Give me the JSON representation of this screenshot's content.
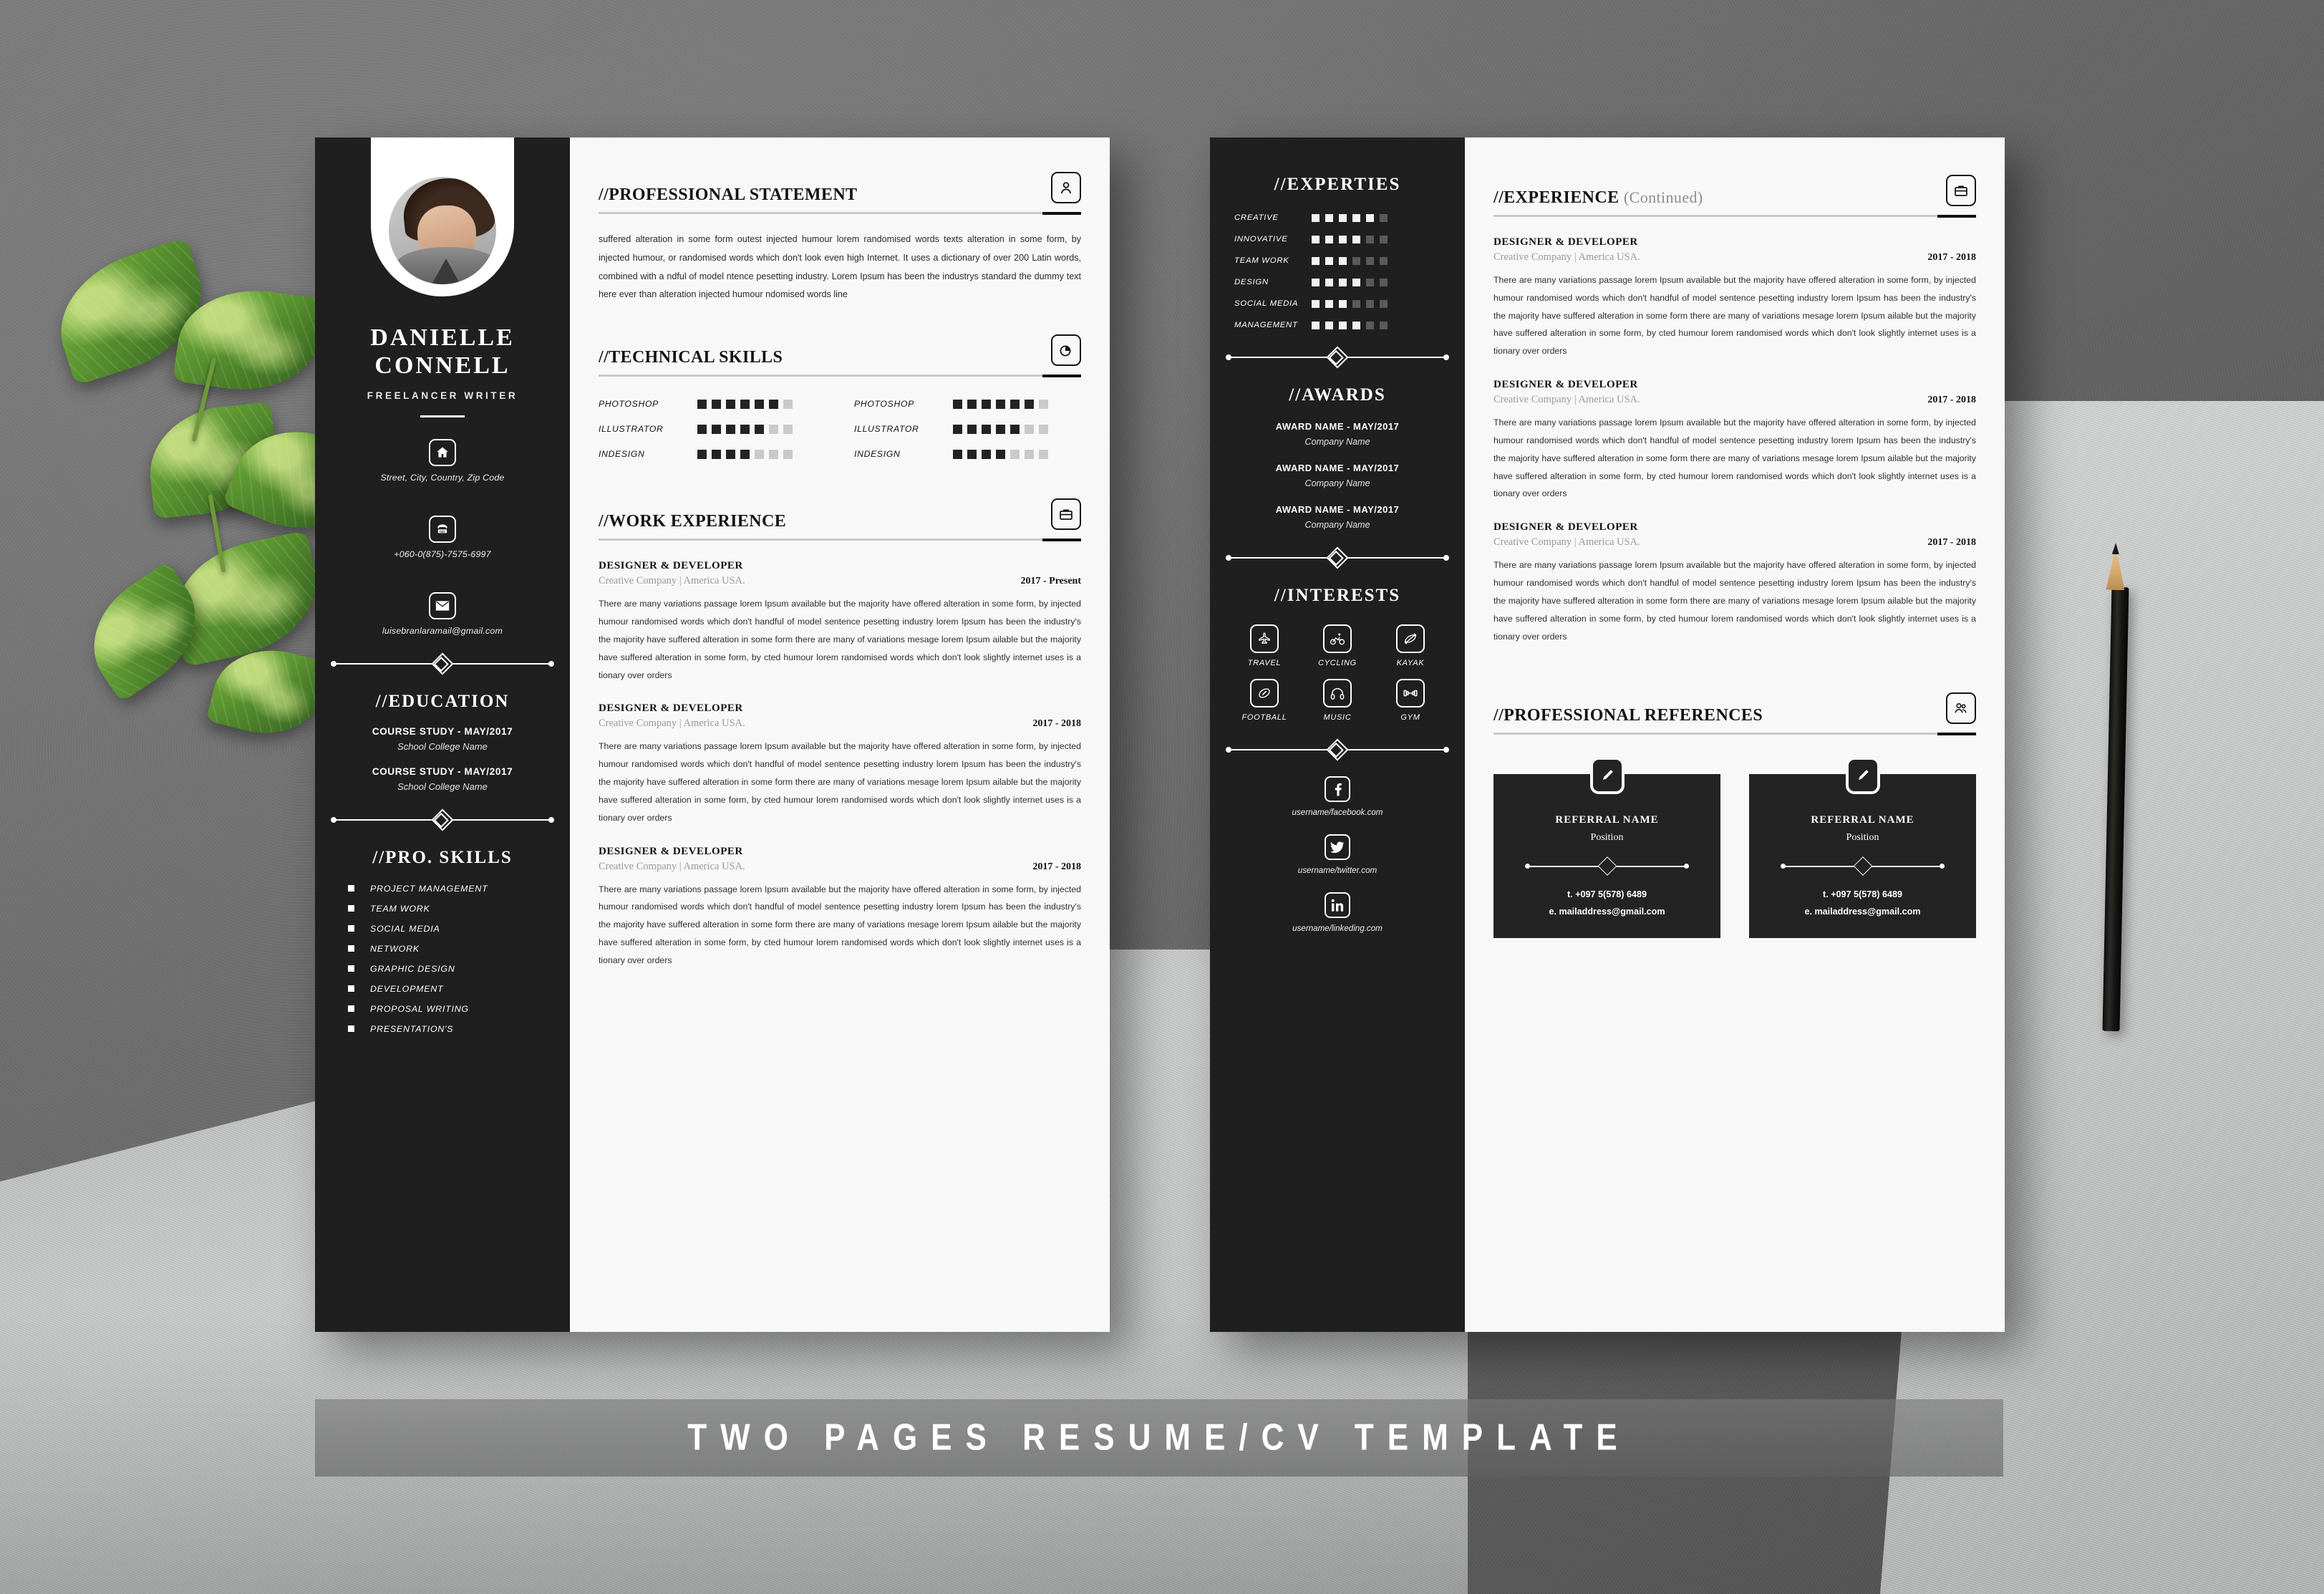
{
  "banner": {
    "text": "TWO PAGES RESUME/CV TEMPLATE"
  },
  "profile": {
    "first_name": "DANIELLE",
    "last_name": "CONNELL",
    "role": "FREELANCER WRITER",
    "photo_alt": "portrait-photo"
  },
  "contact": [
    {
      "icon": "home-icon",
      "glyph": "⌂",
      "text": "Street, City, Country, Zip Code"
    },
    {
      "icon": "phone-icon",
      "glyph": "☎",
      "text": "+060-0(875)-7575-6997"
    },
    {
      "icon": "mail-icon",
      "glyph": "✉",
      "text": "luisebranlaramail@gmail.com"
    }
  ],
  "education": {
    "heading": "//EDUCATION",
    "items": [
      {
        "title": "COURSE STUDY - MAY/2017",
        "school": "School College Name"
      },
      {
        "title": "COURSE STUDY - MAY/2017",
        "school": "School College Name"
      }
    ]
  },
  "pro_skills": {
    "heading": "//PRO. SKILLS",
    "items": [
      "PROJECT MANAGEMENT",
      "TEAM WORK",
      "SOCIAL MEDIA",
      "NETWORK",
      "GRAPHIC DESIGN",
      "DEVELOPMENT",
      "PROPOSAL WRITING",
      "PRESENTATION'S"
    ]
  },
  "professional_statement": {
    "heading": "//PROFESSIONAL STATEMENT",
    "icon": "person-card-icon",
    "text": "suffered alteration in some form outest injected humour lorem randomised words texts alteration in some form, by injected humour, or randomised words which don't look even high Internet. It uses a dictionary of over 200 Latin words, combined with a ndful of model ntence pesetting industry. Lorem Ipsum has been the industrys standard the dummy text here ever than alteration injected humour ndomised words line"
  },
  "technical_skills": {
    "heading": "//TECHNICAL SKILLS",
    "icon": "pie-chart-icon",
    "total": 7,
    "columns": [
      [
        {
          "label": "PHOTOSHOP",
          "value": 6
        },
        {
          "label": "ILLUSTRATOR",
          "value": 5
        },
        {
          "label": "INDESIGN",
          "value": 4
        }
      ],
      [
        {
          "label": "PHOTOSHOP",
          "value": 6
        },
        {
          "label": "ILLUSTRATOR",
          "value": 5
        },
        {
          "label": "INDESIGN",
          "value": 4
        }
      ]
    ]
  },
  "work_experience": {
    "heading": "//WORK EXPERIENCE",
    "icon": "briefcase-icon",
    "jobs": [
      {
        "title": "DESIGNER & DEVELOPER",
        "company": "Creative Company | America USA.",
        "date": "2017 - Present",
        "desc": "There are many variations passage lorem Ipsum available but the majority have offered alteration in some form, by injected humour randomised words which don't handful of model sentence pesetting industry lorem Ipsum has been the industry's the majority have suffered alteration in some form there are many of variations mesage lorem Ipsum ailable but the majority have suffered alteration in some form, by cted humour lorem randomised words which don't look slightly internet uses is a tionary over orders"
      },
      {
        "title": "DESIGNER & DEVELOPER",
        "company": "Creative Company | America USA.",
        "date": "2017 - 2018",
        "desc": "There are many variations passage lorem Ipsum available but the majority have offered alteration in some form, by injected humour randomised words which don't handful of model sentence pesetting industry lorem Ipsum has been the industry's the majority have suffered alteration in some form there are many of variations mesage lorem Ipsum ailable but the majority have suffered alteration in some form, by cted humour lorem randomised words which don't look slightly internet uses is a tionary over orders"
      },
      {
        "title": "DESIGNER & DEVELOPER",
        "company": "Creative Company | America USA.",
        "date": "2017 - 2018",
        "desc": "There are many variations passage lorem Ipsum available but the majority have offered alteration in some form, by injected humour randomised words which don't handful of model sentence pesetting industry lorem Ipsum has been the industry's the majority have suffered alteration in some form there are many of variations mesage lorem Ipsum ailable but the majority have suffered alteration in some form, by cted humour lorem randomised words which don't look slightly internet uses is a tionary over orders"
      }
    ]
  },
  "experties": {
    "heading": "//EXPERTIES",
    "total": 6,
    "items": [
      {
        "label": "CREATIVE",
        "value": 5
      },
      {
        "label": "INNOVATIVE",
        "value": 4
      },
      {
        "label": "TEAM WORK",
        "value": 3
      },
      {
        "label": "DESIGN",
        "value": 4
      },
      {
        "label": "SOCIAL MEDIA",
        "value": 3
      },
      {
        "label": "MANAGEMENT",
        "value": 4
      }
    ]
  },
  "awards": {
    "heading": "//AWARDS",
    "items": [
      {
        "title": "AWARD NAME - MAY/2017",
        "company": "Company Name"
      },
      {
        "title": "AWARD NAME - MAY/2017",
        "company": "Company Name"
      },
      {
        "title": "AWARD NAME - MAY/2017",
        "company": "Company Name"
      }
    ]
  },
  "interests": {
    "heading": "//INTERESTS",
    "items": [
      {
        "label": "TRAVEL",
        "icon": "airplane-icon"
      },
      {
        "label": "CYCLING",
        "icon": "cyclist-icon"
      },
      {
        "label": "KAYAK",
        "icon": "kayak-icon"
      },
      {
        "label": "FOOTBALL",
        "icon": "football-icon"
      },
      {
        "label": "MUSIC",
        "icon": "headphones-icon"
      },
      {
        "label": "GYM",
        "icon": "dumbbell-icon"
      }
    ]
  },
  "social": [
    {
      "icon": "facebook-icon",
      "glyph": "f",
      "text": "username/facebook.com"
    },
    {
      "icon": "twitter-icon",
      "glyph": "ᵗ",
      "text": "username/twitter.com"
    },
    {
      "icon": "linkedin-icon",
      "glyph": "in",
      "text": "username/linkeding.com"
    }
  ],
  "experience_continued": {
    "heading": "//EXPERIENCE",
    "heading_suffix": "(Continued)",
    "icon": "briefcase-icon",
    "jobs": [
      {
        "title": "DESIGNER & DEVELOPER",
        "company": "Creative Company | America USA.",
        "date": "2017 - 2018",
        "desc": "There are many variations passage lorem Ipsum available but the majority have offered alteration in some form, by injected humour randomised words which don't handful of model sentence pesetting industry lorem Ipsum has been the industry's the majority have suffered alteration in some form there are many of variations mesage lorem Ipsum ailable but the majority have suffered alteration in some form, by cted humour lorem randomised words which don't look slightly internet uses is a tionary over orders"
      },
      {
        "title": "DESIGNER & DEVELOPER",
        "company": "Creative Company | America USA.",
        "date": "2017 - 2018",
        "desc": "There are many variations passage lorem Ipsum available but the majority have offered alteration in some form, by injected humour randomised words which don't handful of model sentence pesetting industry lorem Ipsum has been the industry's the majority have suffered alteration in some form there are many of variations mesage lorem Ipsum ailable but the majority have suffered alteration in some form, by cted humour lorem randomised words which don't look slightly internet uses is a tionary over orders"
      },
      {
        "title": "DESIGNER & DEVELOPER",
        "company": "Creative Company | America USA.",
        "date": "2017 - 2018",
        "desc": "There are many variations passage lorem Ipsum available but the majority have offered alteration in some form, by injected humour randomised words which don't handful of model sentence pesetting industry lorem Ipsum has been the industry's the majority have suffered alteration in some form there are many of variations mesage lorem Ipsum ailable but the majority have suffered alteration in some form, by cted humour lorem randomised words which don't look slightly internet uses is a tionary over orders"
      }
    ]
  },
  "references": {
    "heading": "//PROFESSIONAL REFERENCES",
    "icon": "people-card-icon",
    "cards": [
      {
        "badge_icon": "pen-icon",
        "name": "REFERRAL NAME",
        "position": "Position",
        "tel": "t. +097 5(578) 6489",
        "mail": "e. mailaddress@gmail.com"
      },
      {
        "badge_icon": "pen-icon",
        "name": "REFERRAL NAME",
        "position": "Position",
        "tel": "t. +097 5(578) 6489",
        "mail": "e. mailaddress@gmail.com"
      }
    ]
  },
  "colors": {
    "dark": "#1f1f1f",
    "paper": "#f8f8f8",
    "rule_light": "#c9c9c9",
    "muted": "#9a9a9a",
    "backdrop": "#6d6d6d"
  }
}
